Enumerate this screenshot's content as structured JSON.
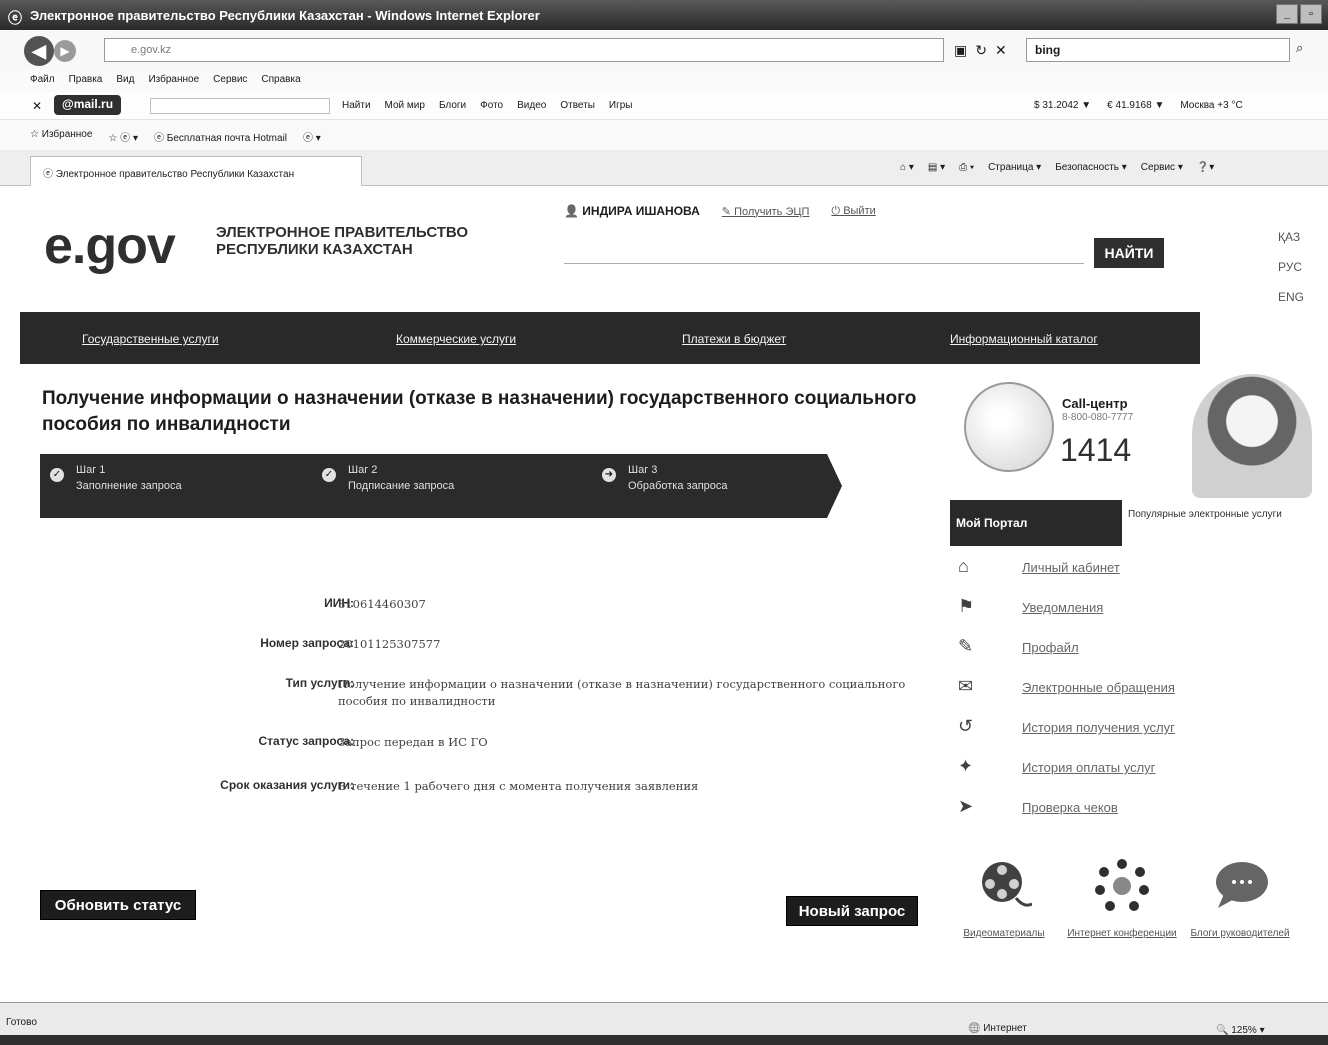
{
  "window": {
    "title": "Электронное правительство Республики Казахстан - Windows Internet Explorer",
    "url_domain": "e.gov.kz",
    "search_engine": "bing"
  },
  "menu": [
    "Файл",
    "Правка",
    "Вид",
    "Избранное",
    "Сервис",
    "Справка"
  ],
  "mailru_bar": {
    "logo": "@mail.ru",
    "links": [
      "Найти",
      "Мой мир",
      "Блоги",
      "Фото",
      "Видео",
      "Ответы",
      "Игры"
    ],
    "usd_rate": "$ 31.2042 ▼",
    "eur_rate": "€ 41.9168 ▼",
    "weather": "Москва +3 °С"
  },
  "favorites_bar": {
    "label": "Избранное",
    "hotmail": "Бесплатная почта Hotmail"
  },
  "tab": {
    "title": "Электронное правительство Республики Казахстан"
  },
  "command_bar": [
    "Страница ▾",
    "Безопасность ▾",
    "Сервис ▾"
  ],
  "site": {
    "logo": "e.gov",
    "logo_text_line1": "ЭЛЕКТРОННОЕ ПРАВИТЕЛЬСТВО",
    "logo_text_line2": "РЕСПУБЛИКИ КАЗАХСТАН",
    "user_name": "ИНДИРА ИШАНОВА",
    "get_eds": "Получить ЭЦП",
    "logout": "Выйти",
    "find_button": "НАЙТИ",
    "langs": [
      "ҚАЗ",
      "РУС",
      "ENG"
    ],
    "nav": [
      "Государственные услуги",
      "Коммерческие услуги",
      "Платежи в бюджет",
      "Информационный каталог"
    ]
  },
  "main": {
    "title": "Получение информации о назначении (отказе в назначении) государственного социального пособия по инвалидности",
    "steps": [
      {
        "num": "Шаг 1",
        "label": "Заполнение запроса"
      },
      {
        "num": "Шаг 2",
        "label": "Подписание запроса"
      },
      {
        "num": "Шаг 3",
        "label": "Обработка запроса"
      }
    ],
    "fields": [
      {
        "key": "ИИН:",
        "value": "810614460307"
      },
      {
        "key": "Номер запроса:",
        "value": "20101125307577"
      },
      {
        "key": "Тип услуги:",
        "value": "Получение информации о назначении (отказе в назначении) государственного социального пособия по инвалидности"
      },
      {
        "key": "Статус запроса:",
        "value": "Запрос передан в ИС ГО"
      },
      {
        "key": "Срок оказания услуги:",
        "value": "В течение 1 рабочего дня с момента получения заявления"
      }
    ],
    "refresh_button": "Обновить статус",
    "new_request_button": "Новый запрос"
  },
  "sidebar": {
    "call_center_title": "Call-центр",
    "call_center_phone": "8-800-080-7777",
    "call_center_short": "1414",
    "tab_active": "Мой Портал",
    "tab_other": "Популярные электронные услуги",
    "portal_items": [
      {
        "icon": "home-icon",
        "label": "Личный кабинет"
      },
      {
        "icon": "notification-icon",
        "label": "Уведомления"
      },
      {
        "icon": "pencil-icon",
        "label": "Профайл"
      },
      {
        "icon": "mail-icon",
        "label": "Электронные обращения"
      },
      {
        "icon": "history-icon",
        "label": "История получения услуг"
      },
      {
        "icon": "payment-icon",
        "label": "История оплаты услуг"
      },
      {
        "icon": "check-icon",
        "label": "Проверка чеков"
      }
    ],
    "media": [
      {
        "icon": "film-reel-icon",
        "label": "Видеоматериалы"
      },
      {
        "icon": "conference-icon",
        "label": "Интернет конференции"
      },
      {
        "icon": "chat-bubble-icon",
        "label": "Блоги руководителей"
      }
    ]
  },
  "statusbar": {
    "ready": "Готово",
    "zone": "Интернет",
    "zoom": "125%"
  }
}
